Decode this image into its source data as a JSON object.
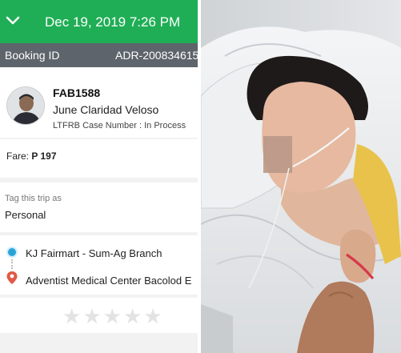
{
  "header": {
    "datetime": "Dec 19, 2019 7:26 PM",
    "collapse_icon": "chevron-down-icon"
  },
  "booking": {
    "label": "Booking ID",
    "id": "ADR-200834615"
  },
  "driver": {
    "plate": "FAB1588",
    "name": "June Claridad Veloso",
    "case_number": "LTFRB Case Number : In Process"
  },
  "fare": {
    "label": "Fare:",
    "amount": "P 197"
  },
  "tag": {
    "label": "Tag this trip as",
    "value": "Personal"
  },
  "route": {
    "pickup": "KJ Fairmart - Sum-Ag Branch",
    "dropoff": "Adventist Medical Center Bacolod E"
  },
  "rating": {
    "max_stars": 5,
    "current": 0
  },
  "colors": {
    "header_green": "#1fae55",
    "booking_bar": "#5e646b",
    "pickup_blue": "#2aa4d8",
    "dropoff_red": "#e05a47"
  }
}
